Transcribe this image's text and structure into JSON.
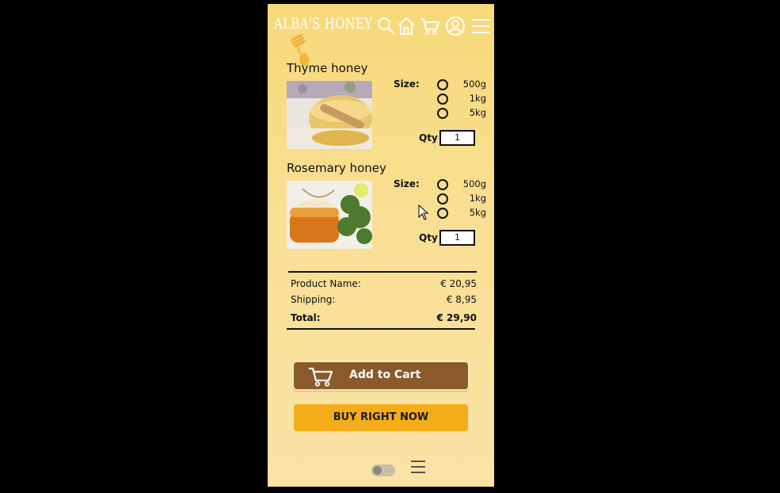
{
  "brand": {
    "logo_text": "ALBA'S HONEY"
  },
  "header_icons": [
    "search-icon",
    "home-icon",
    "cart-icon",
    "user-icon",
    "menu-icon"
  ],
  "products": [
    {
      "name": "Thyme honey",
      "size_label": "Size:",
      "sizes": [
        "500g",
        "1kg",
        "5kg"
      ],
      "qty_label": "Qty",
      "qty_value": "1"
    },
    {
      "name": "Rosemary honey",
      "size_label": "Size:",
      "sizes": [
        "500g",
        "1kg",
        "5kg"
      ],
      "qty_label": "Qty",
      "qty_value": "1"
    }
  ],
  "summary": {
    "product_label": "Product Name:",
    "product_price": "€ 20,95",
    "shipping_label": "Shipping:",
    "shipping_price": "€ 8,95",
    "total_label": "Total:",
    "total_price": "€ 29,90"
  },
  "actions": {
    "add_to_cart": "Add to Cart",
    "buy_now": "BUY RIGHT NOW"
  },
  "colors": {
    "background": "#f9df93",
    "cart_button": "#8a5a2b",
    "buy_button": "#f4ad18"
  }
}
